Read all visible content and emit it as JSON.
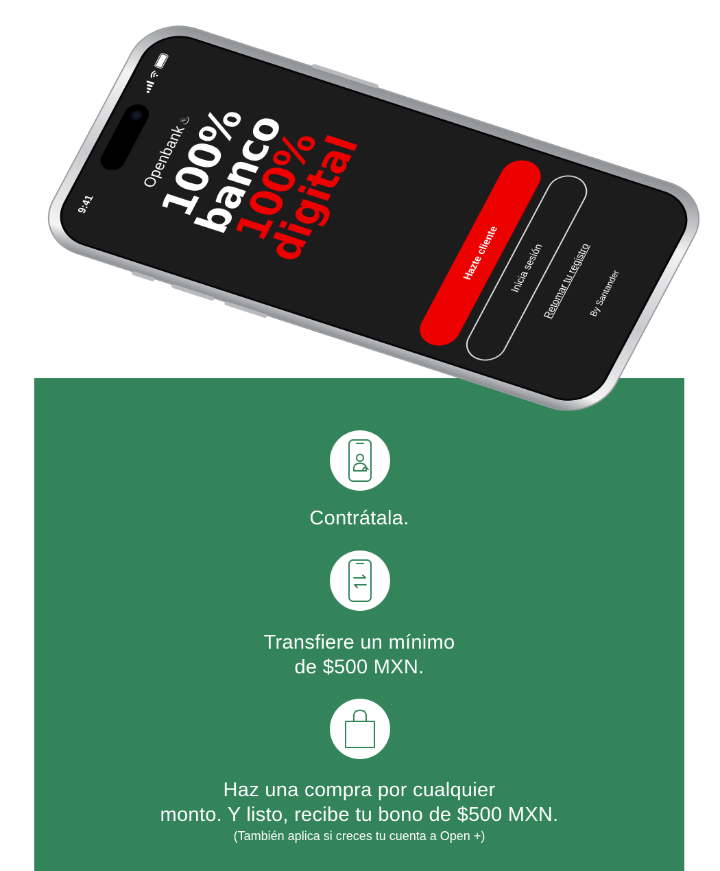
{
  "phone": {
    "status_time": "9:41",
    "brand": "Openbank",
    "hero_line1": "100%",
    "hero_line2": "banco",
    "hero_line3": "100%",
    "hero_line4": "digital",
    "primary_cta": "Hazte cliente",
    "secondary_cta": "Inicia sesión",
    "link": "Retomar tu registro",
    "footer": "By Santander"
  },
  "steps": [
    {
      "icon": "phone-user-icon",
      "title": "Contrátala."
    },
    {
      "icon": "phone-transfer-icon",
      "title_line1": "Transfiere un mínimo",
      "title_line2": "de $500 MXN."
    },
    {
      "icon": "shopping-bag-icon",
      "title_line1": "Haz una compra por cualquier",
      "title_line2": "monto. Y listo, recibe tu bono de $500 MXN.",
      "note": "(También aplica si creces tu cuenta a Open +)"
    }
  ],
  "colors": {
    "panel_green": "#33845b",
    "brand_red": "#ec0000",
    "screen_dark": "#1c1c1d"
  }
}
